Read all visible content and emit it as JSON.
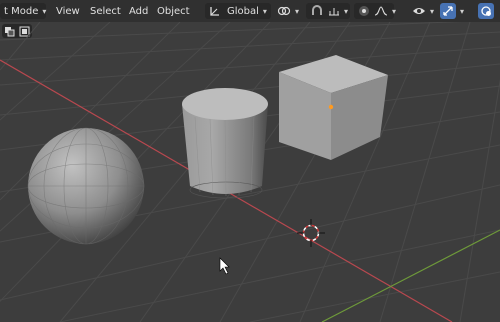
{
  "header": {
    "mode_label": "t Mode",
    "menus": [
      "View",
      "Select",
      "Add",
      "Object"
    ],
    "transform_orientation": "Global"
  },
  "icons": {
    "mode": "object-mode-icon",
    "orientation": "transform-orientation-icon",
    "pivot": "pivot-point-icon",
    "snap": "snap-icon",
    "snap_target": "snap-increment-icon",
    "proportional": "proportional-editing-icon",
    "falloff": "falloff-curve-icon",
    "visibility": "eye-visibility-icon",
    "gizmo": "gizmo-icon",
    "overlay": "overlay-icon",
    "select_box": "select-box-icon",
    "select_mode": "select-mode-icon",
    "cursor": "3d-cursor-icon",
    "mouse": "mouse-pointer-icon"
  },
  "colors": {
    "background": "#3d3d3d",
    "header": "#303030",
    "grid": "#4a4a4a",
    "x_axis": "#b8484f",
    "y_axis": "#6e9a3a",
    "accent": "#4772b3",
    "selection_origin": "#ff9a1f"
  },
  "scene": {
    "objects": [
      "sphere",
      "cylinder",
      "cube"
    ]
  }
}
